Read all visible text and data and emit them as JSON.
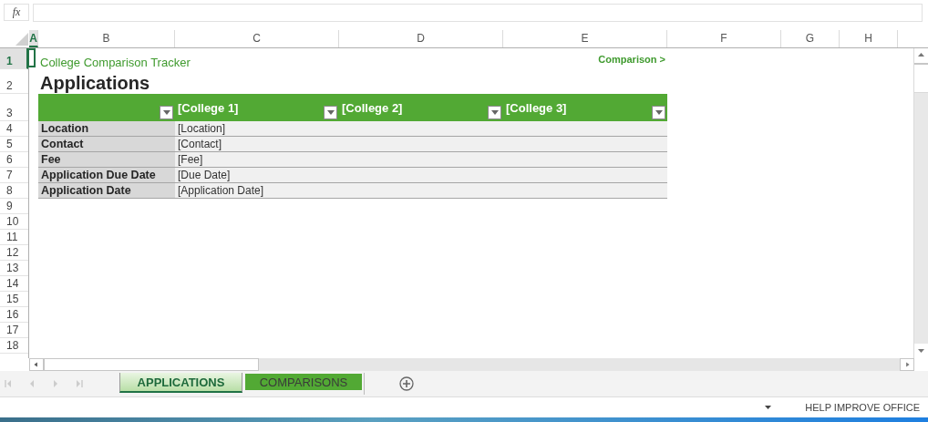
{
  "formula_bar": {
    "function_label": "fx"
  },
  "column_headers": [
    {
      "label": "A",
      "selected": true
    },
    {
      "label": "B",
      "selected": false
    },
    {
      "label": "C",
      "selected": false
    },
    {
      "label": "D",
      "selected": false
    },
    {
      "label": "E",
      "selected": false
    },
    {
      "label": "F",
      "selected": false
    },
    {
      "label": "G",
      "selected": false
    },
    {
      "label": "H",
      "selected": false
    }
  ],
  "row_headers": [
    {
      "label": "1",
      "selected": true
    },
    {
      "label": "2",
      "selected": false
    },
    {
      "label": "3",
      "selected": false
    },
    {
      "label": "4",
      "selected": false
    },
    {
      "label": "5",
      "selected": false
    },
    {
      "label": "6",
      "selected": false
    },
    {
      "label": "7",
      "selected": false
    },
    {
      "label": "8",
      "selected": false
    },
    {
      "label": "9",
      "selected": false
    },
    {
      "label": "10",
      "selected": false
    },
    {
      "label": "11",
      "selected": false
    },
    {
      "label": "12",
      "selected": false
    },
    {
      "label": "13",
      "selected": false
    },
    {
      "label": "14",
      "selected": false
    },
    {
      "label": "15",
      "selected": false
    },
    {
      "label": "16",
      "selected": false
    },
    {
      "label": "17",
      "selected": false
    },
    {
      "label": "18",
      "selected": false
    }
  ],
  "sheet": {
    "title": "College Comparison Tracker",
    "link": "Comparison >",
    "heading": "Applications",
    "table": {
      "columns": [
        {
          "label": "[College 1]"
        },
        {
          "label": "[College 2]"
        },
        {
          "label": "[College 3]"
        }
      ],
      "rows": [
        {
          "label": "Location",
          "value": "[Location]"
        },
        {
          "label": "Contact",
          "value": "[Contact]"
        },
        {
          "label": "Fee",
          "value": "[Fee]"
        },
        {
          "label": "Application Due Date",
          "value": "[Due Date]"
        },
        {
          "label": "Application Date",
          "value": "[Application Date]"
        }
      ]
    }
  },
  "sheet_tabs": [
    {
      "label": "APPLICATIONS",
      "selected": true
    },
    {
      "label": "COMPARISONS",
      "selected": false
    }
  ],
  "status_bar": {
    "text": "HELP IMPROVE OFFICE"
  }
}
